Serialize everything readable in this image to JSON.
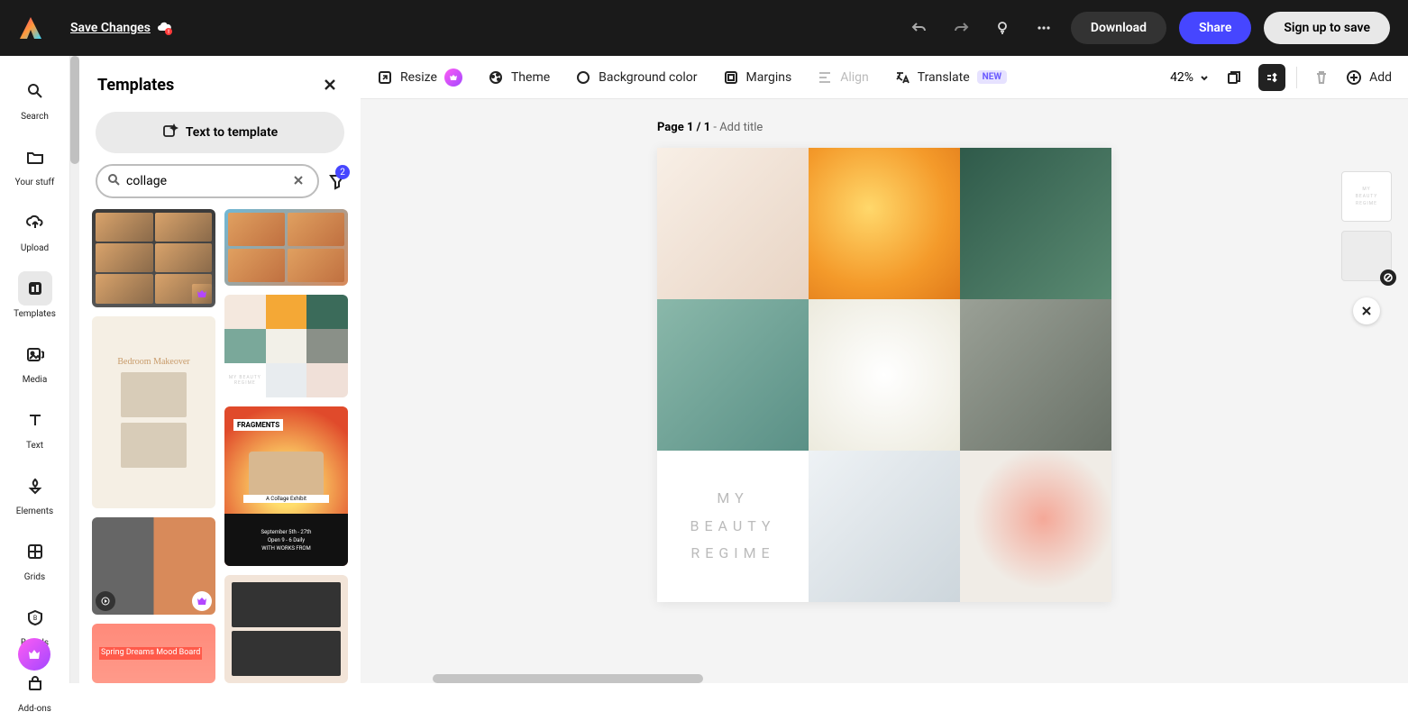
{
  "topbar": {
    "save_label": "Save Changes",
    "download_label": "Download",
    "share_label": "Share",
    "signup_label": "Sign up to save"
  },
  "iconbar": {
    "items": [
      {
        "label": "Search"
      },
      {
        "label": "Your stuff"
      },
      {
        "label": "Upload"
      },
      {
        "label": "Templates"
      },
      {
        "label": "Media"
      },
      {
        "label": "Text"
      },
      {
        "label": "Elements"
      },
      {
        "label": "Grids"
      },
      {
        "label": "Brands"
      },
      {
        "label": "Add-ons"
      }
    ]
  },
  "templates": {
    "title": "Templates",
    "text_to_template_label": "Text to template",
    "search_value": "collage",
    "filter_count": "2",
    "thumbs": {
      "bedroom_title": "Bedroom Makeover",
      "fragments_label": "FRAGMENTS",
      "fragments_sub": "A Collage Exhibit",
      "fragments_dates": "September 5th - 27th",
      "fragments_hours": "Open 9 - 6 Daily",
      "fragments_works": "WITH WORKS FROM",
      "spring_text": "Spring Dreams Mood Board",
      "beauty_thumb_text": "MY BEAUTY REGIME"
    }
  },
  "toolbar": {
    "resize": "Resize",
    "theme": "Theme",
    "background": "Background color",
    "margins": "Margins",
    "align": "Align",
    "translate": "Translate",
    "translate_badge": "NEW",
    "zoom": "42%",
    "add": "Add"
  },
  "canvas": {
    "page_label_prefix": "Page 1 / 1",
    "page_label_suffix": " - Add title",
    "beauty_line1": "MY",
    "beauty_line2": "BEAUTY",
    "beauty_line3": "REGIME"
  },
  "colors": {
    "hands": "#f4e8de",
    "oranges": "#f4a836",
    "leaf": "#3b6b5a",
    "sink": "#7aa89a",
    "flatlay": "#f2f0e8",
    "bottle": "#8a9088",
    "products": "#e8ecef",
    "powder": "#f0f0ee"
  }
}
